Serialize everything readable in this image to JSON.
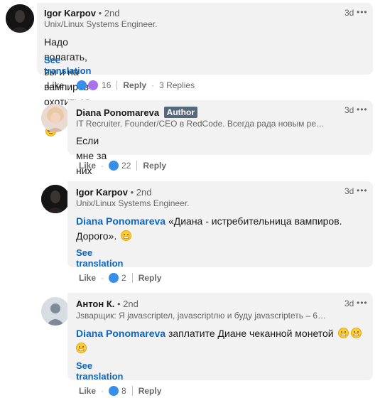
{
  "comments": [
    {
      "name": "Igor Karpov",
      "degree": "• 2nd",
      "headline": "Unix/Linux Systems Engineer.",
      "time": "3d",
      "text": "Надо полагать, вы и на вампиров охотиться можете?",
      "see_translation": "See translation",
      "like": "Like",
      "reaction_count": "16",
      "reply": "Reply",
      "replies": "3 Replies"
    },
    {
      "name": "Diana Ponomareva",
      "author_badge": "Author",
      "headline": "IT Recruiter. Founder/CEO в RedCode. Всегда рада новым резю...",
      "time": "3d",
      "text": "Если мне за них заплатят, то да",
      "like": "Like",
      "reaction_count": "22",
      "reply": "Reply"
    },
    {
      "name": "Igor Karpov",
      "degree": "• 2nd",
      "headline": "Unix/Linux Systems Engineer.",
      "time": "3d",
      "mention": "Diana Ponomareva",
      "text": " «Диана - истребительница вампиров. Дорого».",
      "see_translation": "See translation",
      "like": "Like",
      "reaction_count": "2",
      "reply": "Reply"
    },
    {
      "name": "Антон К.",
      "degree": "• 2nd",
      "headline": "Jsварщик: Я javascriptел, javascriptлю и буду javascriptеть – 6-й ...",
      "time": "3d",
      "mention": "Diana Ponomareva",
      "text": " заплатите Диане чеканной монетой",
      "see_translation": "See translation",
      "like": "Like",
      "reaction_count": "8",
      "reply": "Reply"
    }
  ],
  "more_icon": "•••",
  "colors": {
    "link": "#0a66c2",
    "bubble": "#f2f2f2",
    "badge": "#56687a"
  }
}
